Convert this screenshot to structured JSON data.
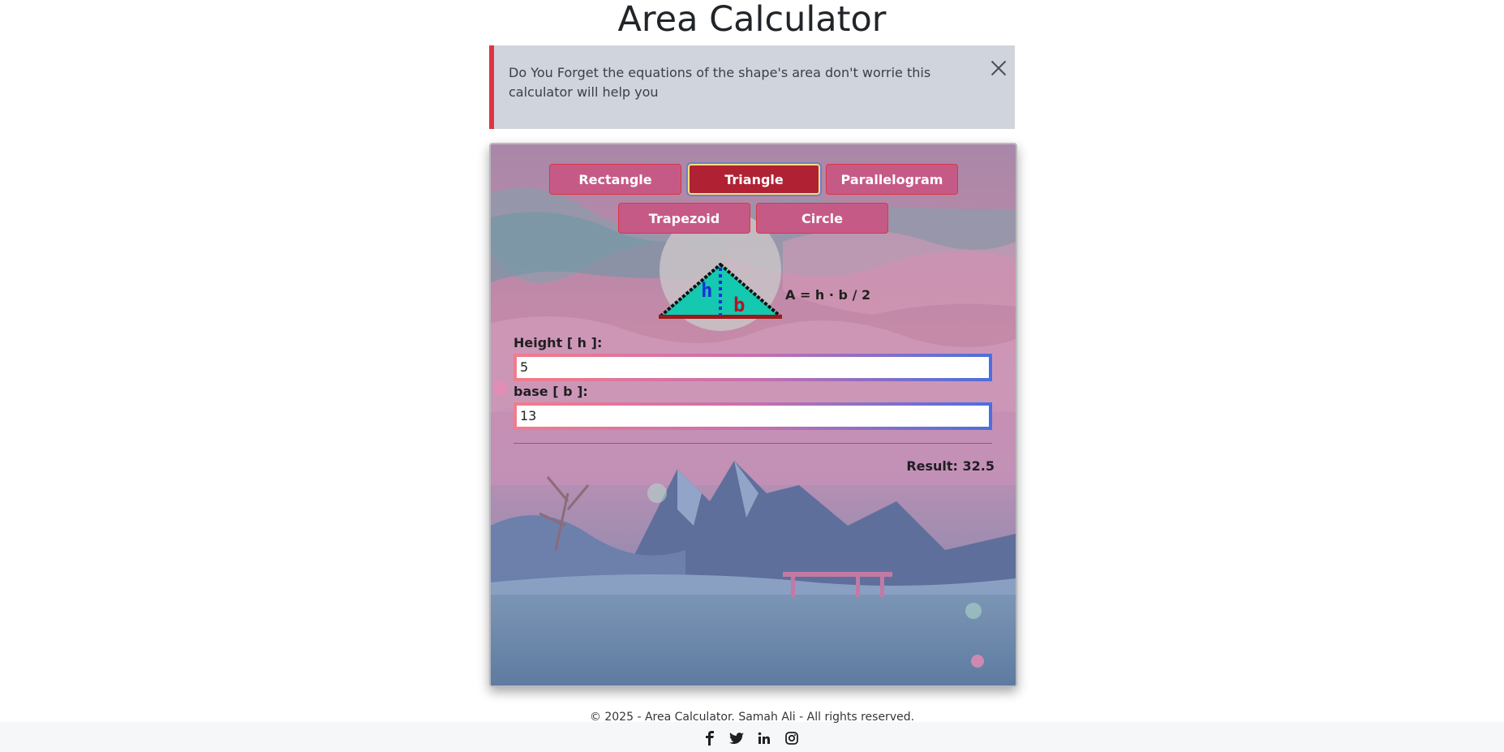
{
  "page": {
    "title": "Area Calculator"
  },
  "alert": {
    "message": "Do You Forget the equations of the shape's area don't worrie this calculator will help you",
    "close_icon": "close-icon",
    "accent": "#dc3545"
  },
  "calculator": {
    "shapes": [
      {
        "label": "Rectangle",
        "active": false
      },
      {
        "label": "Triangle",
        "active": true
      },
      {
        "label": "Parallelogram",
        "active": false
      },
      {
        "label": "Trapezoid",
        "active": false
      },
      {
        "label": "Circle",
        "active": false
      }
    ],
    "illustration": {
      "height_symbol": "h",
      "base_symbol": "b"
    },
    "formula": "A = h · b / 2",
    "fields": [
      {
        "label": "Height [ h ]:",
        "value": "5"
      },
      {
        "label": "base [ b ]:",
        "value": "13"
      }
    ],
    "result": "Result: 32.5"
  },
  "footer": {
    "copyright": "© 2025 - Area Calculator. Samah Ali - All rights reserved.",
    "social_icons": [
      "facebook-icon",
      "twitter-icon",
      "linkedin-icon",
      "instagram-icon"
    ]
  }
}
